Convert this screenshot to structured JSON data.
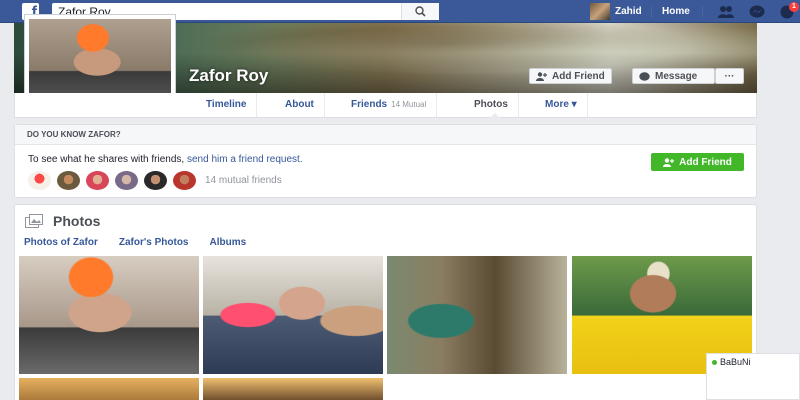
{
  "topbar": {
    "logo": "f",
    "search_value": "Zafor Roy",
    "user_name": "Zahid",
    "home_label": "Home",
    "notification_count": "1"
  },
  "profile": {
    "name": "Zafor Roy",
    "add_friend_label": "Add Friend",
    "message_label": "Message",
    "more_dots": "···"
  },
  "tabs": [
    {
      "label": "Timeline"
    },
    {
      "label": "About"
    },
    {
      "label": "Friends",
      "sub": "14 Mutual"
    },
    {
      "label": "Photos"
    },
    {
      "label": "More ▾"
    }
  ],
  "know": {
    "heading": "DO YOU KNOW ZAFOR?",
    "text_prefix": "To see what he shares with friends, ",
    "link_text": "send him a friend request.",
    "button_label": "Add Friend",
    "mutual_text": "14 mutual friends"
  },
  "photos": {
    "title": "Photos",
    "nav": [
      "Photos of Zafor",
      "Zafor's Photos",
      "Albums"
    ]
  },
  "chat": {
    "name": "BaBuNi"
  },
  "colors": {
    "brand": "#3b5998",
    "link": "#365899",
    "green": "#42b72a",
    "badge": "#fa3e3e"
  }
}
